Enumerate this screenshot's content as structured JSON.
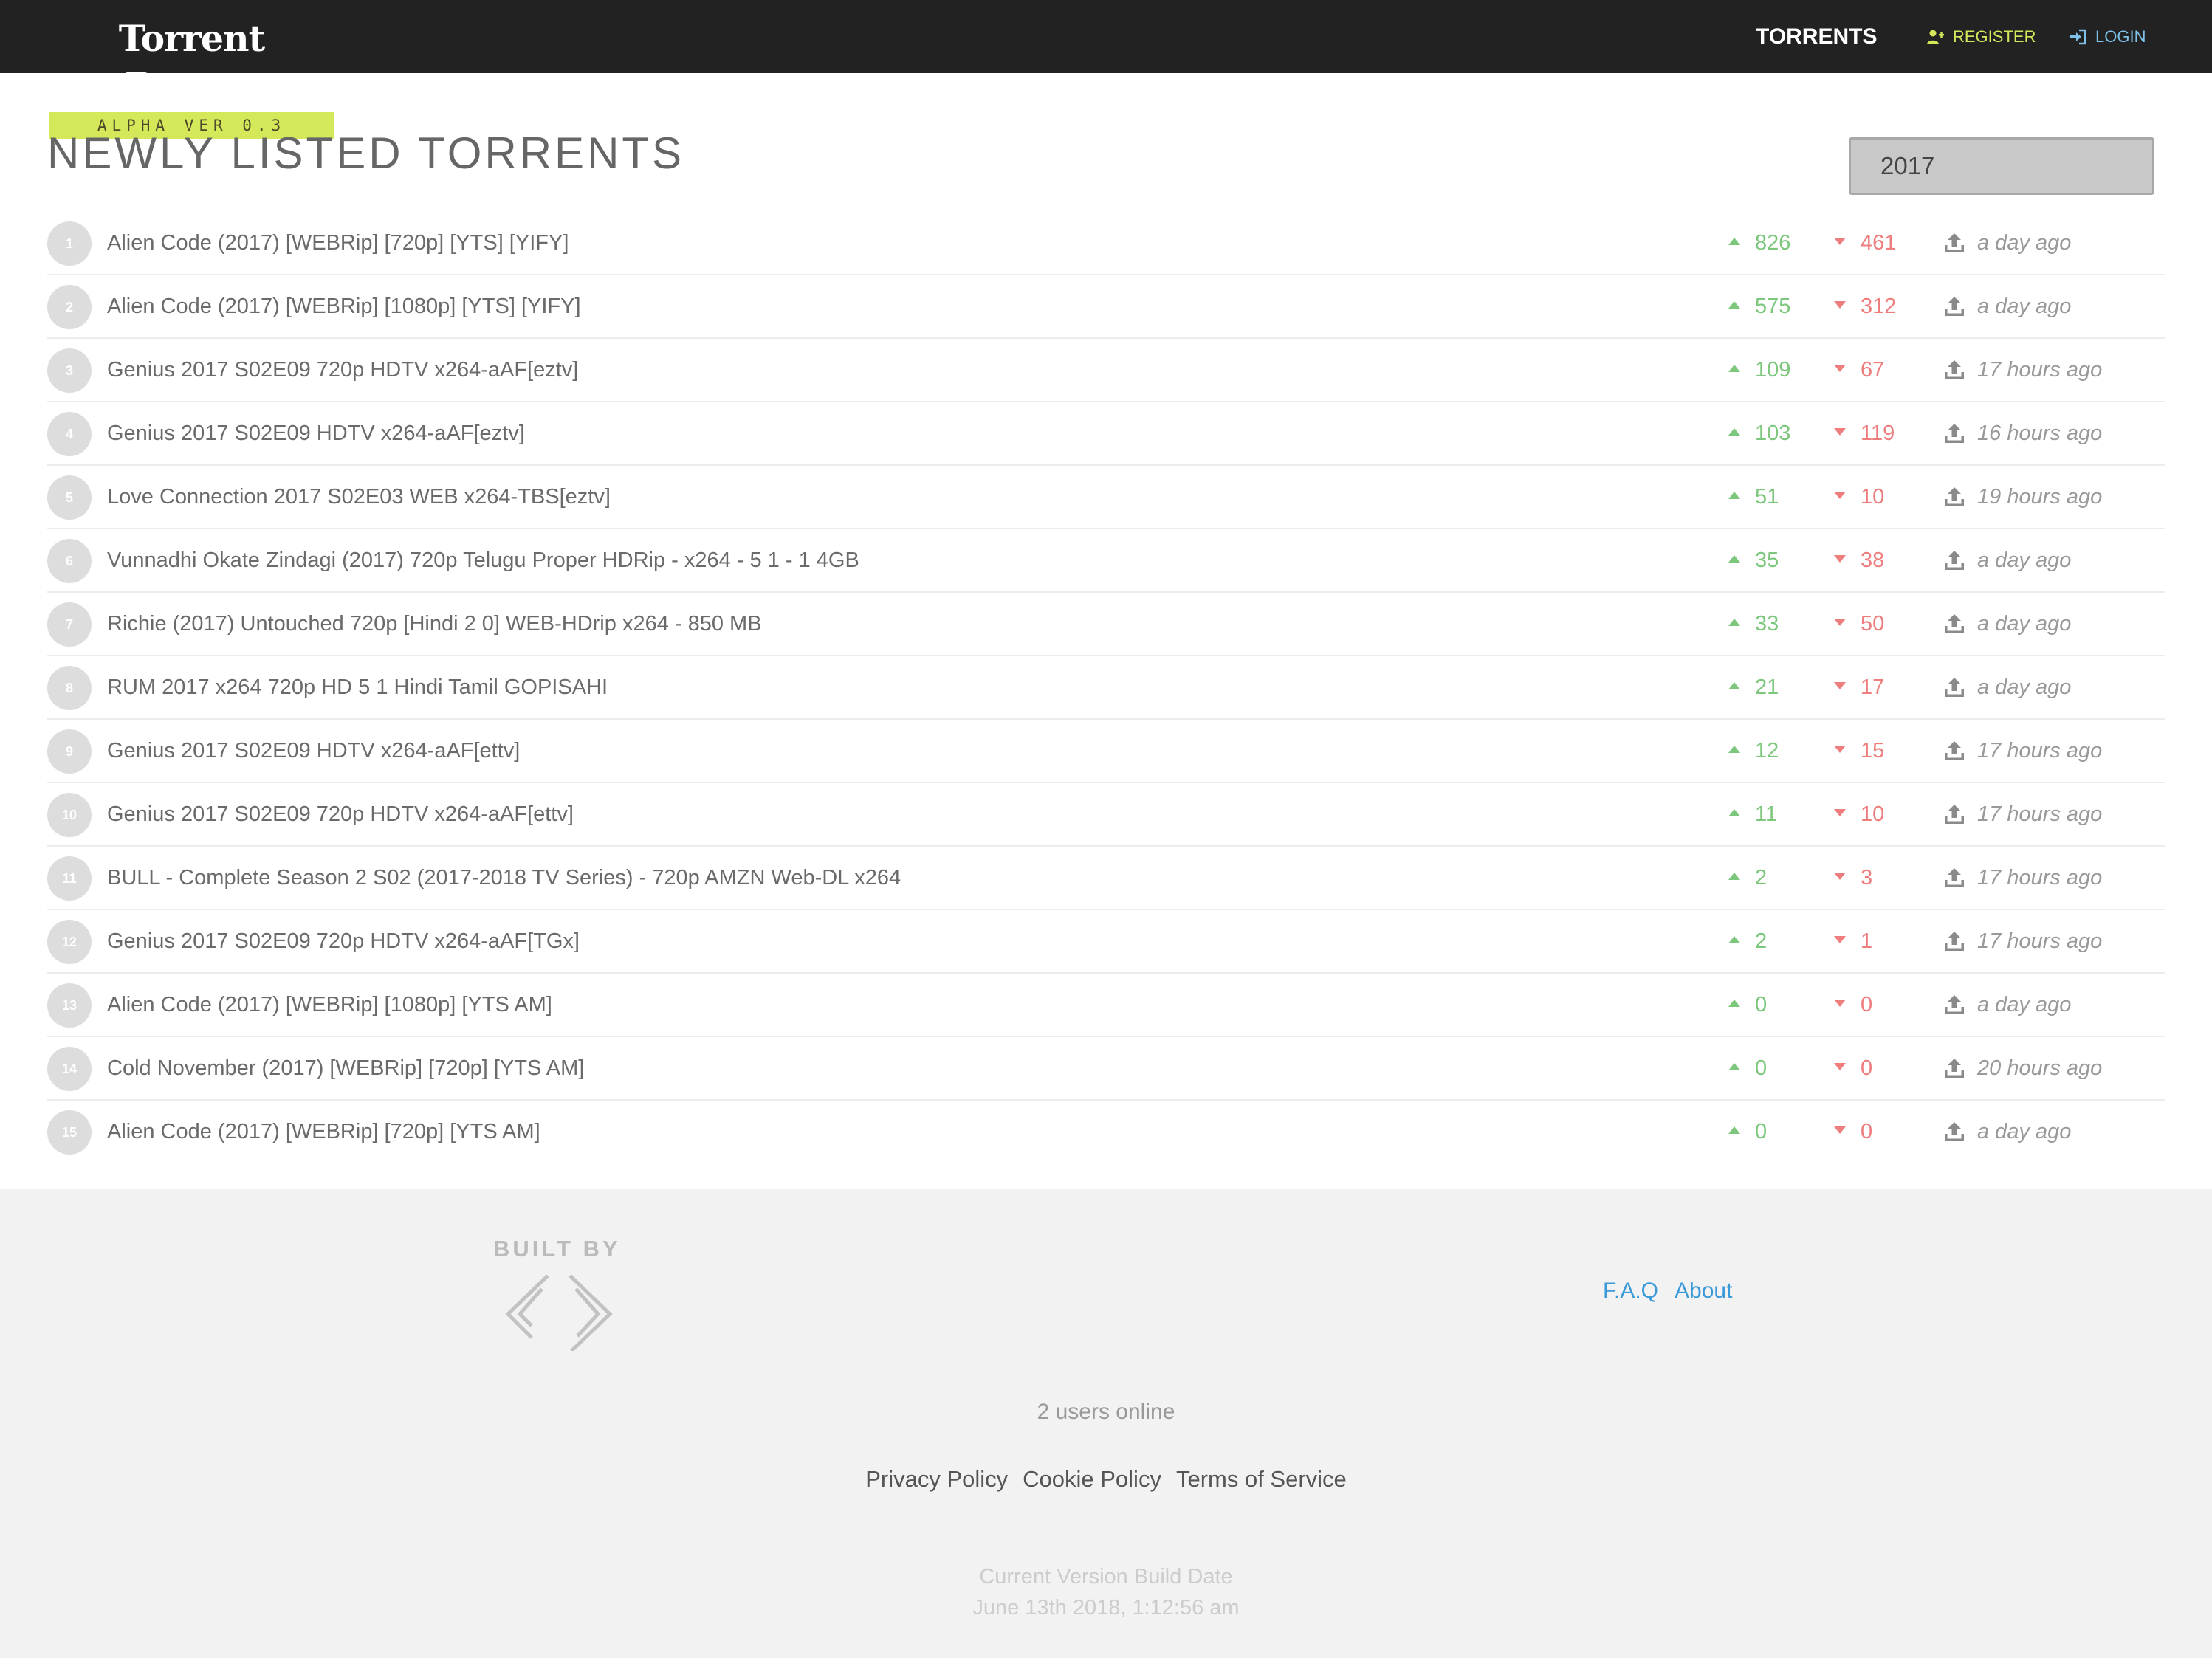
{
  "header": {
    "brand_title": "Torrent Report",
    "brand_version": "ALPHA VER 0.3",
    "nav": {
      "torrents": "TORRENTS",
      "register": "REGISTER",
      "login": "LOGIN"
    },
    "colors": {
      "bar": "#222222",
      "accent": "#d5e85a",
      "login": "#7ec2ea"
    }
  },
  "main": {
    "title": "NEWLY LISTED TORRENTS",
    "search_value": "2017",
    "torrents": [
      {
        "rank": "1",
        "name": "Alien Code (2017) [WEBRip] [720p] [YTS] [YIFY]",
        "seeders": "826",
        "leechers": "461",
        "added": "a day ago"
      },
      {
        "rank": "2",
        "name": "Alien Code (2017) [WEBRip] [1080p] [YTS] [YIFY]",
        "seeders": "575",
        "leechers": "312",
        "added": "a day ago"
      },
      {
        "rank": "3",
        "name": "Genius 2017 S02E09 720p HDTV x264-aAF[eztv]",
        "seeders": "109",
        "leechers": "67",
        "added": "17 hours ago"
      },
      {
        "rank": "4",
        "name": "Genius 2017 S02E09 HDTV x264-aAF[eztv]",
        "seeders": "103",
        "leechers": "119",
        "added": "16 hours ago"
      },
      {
        "rank": "5",
        "name": "Love Connection 2017 S02E03 WEB x264-TBS[eztv]",
        "seeders": "51",
        "leechers": "10",
        "added": "19 hours ago"
      },
      {
        "rank": "6",
        "name": "Vunnadhi Okate Zindagi (2017) 720p Telugu Proper HDRip - x264 - 5 1 - 1 4GB",
        "seeders": "35",
        "leechers": "38",
        "added": "a day ago"
      },
      {
        "rank": "7",
        "name": "Richie (2017) Untouched 720p [Hindi 2 0] WEB-HDrip x264 - 850 MB",
        "seeders": "33",
        "leechers": "50",
        "added": "a day ago"
      },
      {
        "rank": "8",
        "name": "RUM 2017 x264 720p HD 5 1 Hindi Tamil GOPISAHI",
        "seeders": "21",
        "leechers": "17",
        "added": "a day ago"
      },
      {
        "rank": "9",
        "name": "Genius 2017 S02E09 HDTV x264-aAF[ettv]",
        "seeders": "12",
        "leechers": "15",
        "added": "17 hours ago"
      },
      {
        "rank": "10",
        "name": "Genius 2017 S02E09 720p HDTV x264-aAF[ettv]",
        "seeders": "11",
        "leechers": "10",
        "added": "17 hours ago"
      },
      {
        "rank": "11",
        "name": "BULL - Complete Season 2 S02 (2017-2018 TV Series) - 720p AMZN Web-DL x264",
        "seeders": "2",
        "leechers": "3",
        "added": "17 hours ago"
      },
      {
        "rank": "12",
        "name": "Genius 2017 S02E09 720p HDTV x264-aAF[TGx]",
        "seeders": "2",
        "leechers": "1",
        "added": "17 hours ago"
      },
      {
        "rank": "13",
        "name": "Alien Code (2017) [WEBRip] [1080p] [YTS AM]",
        "seeders": "0",
        "leechers": "0",
        "added": "a day ago"
      },
      {
        "rank": "14",
        "name": "Cold November (2017) [WEBRip] [720p] [YTS AM]",
        "seeders": "0",
        "leechers": "0",
        "added": "20 hours ago"
      },
      {
        "rank": "15",
        "name": "Alien Code (2017) [WEBRip] [720p] [YTS AM]",
        "seeders": "0",
        "leechers": "0",
        "added": "a day ago"
      }
    ],
    "icons": {
      "seeders": "arrow-up-icon",
      "leechers": "arrow-down-icon",
      "added": "upload-icon"
    },
    "colors": {
      "seeders": "#7cc77c",
      "leechers": "#ee7d7d"
    }
  },
  "footer": {
    "built_by": "BUILT BY",
    "links": {
      "faq": "F.A.Q",
      "about": "About"
    },
    "users_online": "2 users online",
    "legal": {
      "privacy": "Privacy Policy",
      "cookie": "Cookie Policy",
      "terms": "Terms of Service"
    },
    "build_label": "Current Version Build Date",
    "build_date": "June 13th 2018, 1:12:56 am",
    "colors": {
      "link": "#3a9ad9",
      "background": "#f2f2f2"
    }
  }
}
